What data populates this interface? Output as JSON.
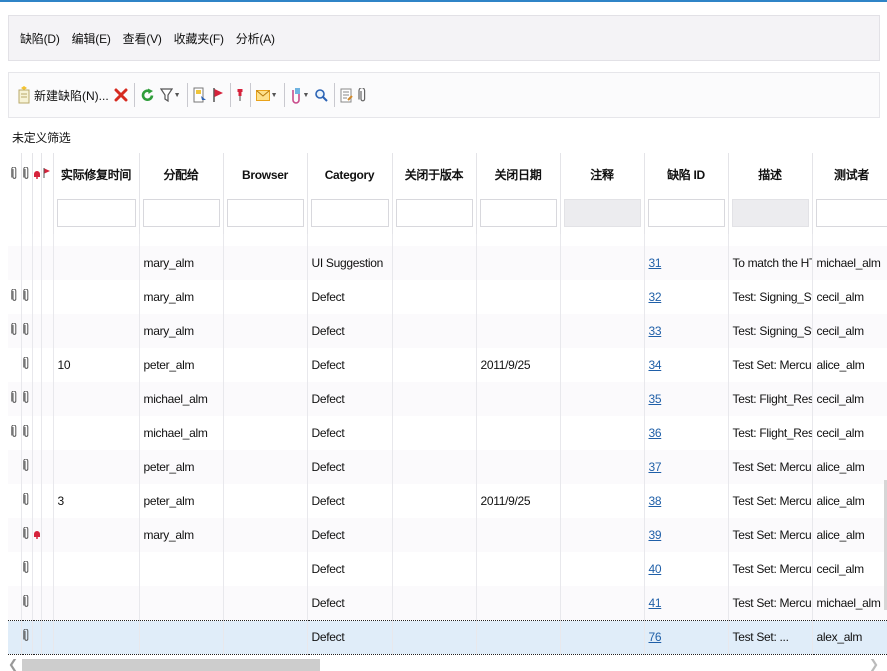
{
  "menubar": {
    "items": [
      "缺陷(D)",
      "编辑(E)",
      "查看(V)",
      "收藏夹(F)",
      "分析(A)"
    ]
  },
  "toolbar": {
    "new_defect_label": "新建缺陷(N)...",
    "icons": [
      "new-defect-icon",
      "delete-icon",
      "refresh-icon",
      "filter-icon",
      "go-to-defect-icon",
      "flag-icon",
      "pin-icon",
      "mail-icon",
      "attach-icon",
      "find-icon",
      "notes-icon",
      "paperclip-icon"
    ],
    "colors": {
      "delete": "#d62b20",
      "refresh": "#2f9d3a",
      "flag": "#d6223b",
      "mail": "#e9a21a"
    }
  },
  "filter_label": "未定义筛选",
  "table": {
    "columns": [
      "实际修复时间",
      "分配给",
      "Browser",
      "Category",
      "关闭于版本",
      "关闭日期",
      "注释",
      "缺陷 ID",
      "描述",
      "测试者"
    ],
    "rows": [
      {
        "att": 0,
        "alert": false,
        "fix": "",
        "assigned": "mary_alm",
        "browser": "",
        "category": "UI Suggestion",
        "ver": "",
        "closed": "",
        "comment": "",
        "id": "31",
        "desc": "To match the HT...",
        "tester": "michael_alm"
      },
      {
        "att": 2,
        "alert": false,
        "fix": "",
        "assigned": "mary_alm",
        "browser": "",
        "category": "Defect",
        "ver": "",
        "closed": "",
        "comment": "",
        "id": "32",
        "desc": "Test: Signing_Str...",
        "tester": "cecil_alm"
      },
      {
        "att": 2,
        "alert": false,
        "fix": "",
        "assigned": "mary_alm",
        "browser": "",
        "category": "Defect",
        "ver": "",
        "closed": "",
        "comment": "",
        "id": "33",
        "desc": "Test: Signing_Str...",
        "tester": "cecil_alm"
      },
      {
        "att": 1,
        "alert": false,
        "fix": "10",
        "assigned": "peter_alm",
        "browser": "",
        "category": "Defect",
        "ver": "",
        "closed": "2011/9/25",
        "comment": "",
        "id": "34",
        "desc": "Test Set: Mercur...",
        "tester": "alice_alm"
      },
      {
        "att": 2,
        "alert": false,
        "fix": "",
        "assigned": "michael_alm",
        "browser": "",
        "category": "Defect",
        "ver": "",
        "closed": "",
        "comment": "",
        "id": "35",
        "desc": "Test: Flight_Res...",
        "tester": "cecil_alm"
      },
      {
        "att": 2,
        "alert": false,
        "fix": "",
        "assigned": "michael_alm",
        "browser": "",
        "category": "Defect",
        "ver": "",
        "closed": "",
        "comment": "",
        "id": "36",
        "desc": "Test: Flight_Res...",
        "tester": "cecil_alm"
      },
      {
        "att": 1,
        "alert": false,
        "fix": "",
        "assigned": "peter_alm",
        "browser": "",
        "category": "Defect",
        "ver": "",
        "closed": "",
        "comment": "",
        "id": "37",
        "desc": "Test Set: Mercur...",
        "tester": "alice_alm"
      },
      {
        "att": 1,
        "alert": false,
        "fix": "3",
        "assigned": "peter_alm",
        "browser": "",
        "category": "Defect",
        "ver": "",
        "closed": "2011/9/25",
        "comment": "",
        "id": "38",
        "desc": "Test Set: Mercur...",
        "tester": "alice_alm"
      },
      {
        "att": 1,
        "alert": true,
        "fix": "",
        "assigned": "mary_alm",
        "browser": "",
        "category": "Defect",
        "ver": "",
        "closed": "",
        "comment": "",
        "id": "39",
        "desc": "Test Set: Mercur...",
        "tester": "alice_alm"
      },
      {
        "att": 1,
        "alert": false,
        "fix": "",
        "assigned": "",
        "browser": "",
        "category": "Defect",
        "ver": "",
        "closed": "",
        "comment": "",
        "id": "40",
        "desc": "Test Set: Mercur...",
        "tester": "cecil_alm"
      },
      {
        "att": 1,
        "alert": false,
        "fix": "",
        "assigned": "",
        "browser": "",
        "category": "Defect",
        "ver": "",
        "closed": "",
        "comment": "",
        "id": "41",
        "desc": "Test Set: Mercur...",
        "tester": "michael_alm"
      },
      {
        "att": 1,
        "alert": false,
        "fix": "",
        "assigned": "",
        "browser": "",
        "category": "Defect",
        "ver": "",
        "closed": "",
        "comment": "",
        "id": "76",
        "desc": "Test Set: ...",
        "tester": "alex_alm",
        "selected": true
      }
    ]
  },
  "colors": {
    "accent": "#2f84c7",
    "link": "#1f5fa8",
    "alert": "#d6223b",
    "selected_row": "#e0edf9"
  }
}
